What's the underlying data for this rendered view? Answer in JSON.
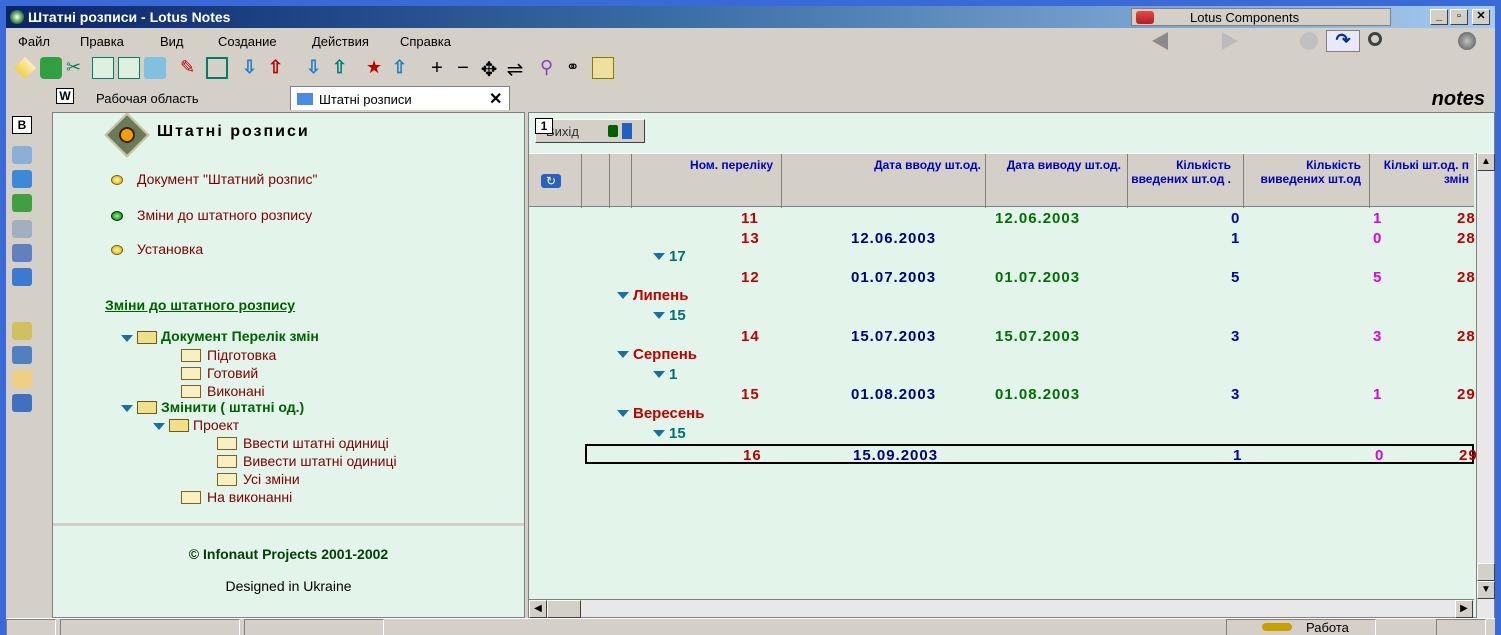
{
  "titlebar": {
    "title": "Штатні розписи - Lotus Notes",
    "components": "Lotus Components",
    "min": "_",
    "max": "▫",
    "close": "✕"
  },
  "menu": [
    "Файл",
    "Правка",
    "Вид",
    "Создание",
    "Действия",
    "Справка"
  ],
  "tabs": {
    "workspace": "Рабочая область",
    "active": "Штатні розписи",
    "close": "✕",
    "w": "W",
    "brand": "notes"
  },
  "left": {
    "title": "Штатні розписи",
    "links": [
      "Документ \"Штатний розпис\"",
      "Зміни до штатного розпису",
      "Установка"
    ],
    "section": "Зміни до штатного розпису",
    "tree": [
      {
        "label": "Документ Перелік змін",
        "level": 0,
        "type": "folder"
      },
      {
        "label": "Підготовка",
        "level": 1,
        "type": "doc"
      },
      {
        "label": "Готовий",
        "level": 1,
        "type": "doc"
      },
      {
        "label": "Виконані",
        "level": 1,
        "type": "doc"
      },
      {
        "label": "Змінити ( штатні од.)",
        "level": 0,
        "type": "folder"
      },
      {
        "label": "Проект",
        "level": 1,
        "type": "folder"
      },
      {
        "label": "Ввести штатні одиниці",
        "level": 2,
        "type": "doc"
      },
      {
        "label": "Вивести штатні одиниці",
        "level": 2,
        "type": "doc"
      },
      {
        "label": "Усі зміни",
        "level": 2,
        "type": "doc"
      },
      {
        "label": "На виконанні",
        "level": 1,
        "type": "doc"
      }
    ],
    "footer": {
      "copyright": "© Infonaut Projects 2001-2002",
      "designed": "Designed in Ukraine"
    },
    "b_label": "B"
  },
  "view": {
    "exit_label": "Вихід",
    "exit_num": "1",
    "columns": [
      "Ном. переліку",
      "Дата вводу шт.од.",
      "Дата виводу шт.од.",
      "Кількість введених шт.од .",
      "Кількість виведених шт.од",
      "Кількі шт.од. п змін"
    ],
    "rows": [
      {
        "kind": "row",
        "num": "11",
        "din": "",
        "dout": "12.06.2003",
        "in": "0",
        "out": "1",
        "tot": "28"
      },
      {
        "kind": "row",
        "num": "13",
        "din": "12.06.2003",
        "dout": "",
        "in": "1",
        "out": "0",
        "tot": "28"
      },
      {
        "kind": "sub",
        "label": "17"
      },
      {
        "kind": "row",
        "num": "12",
        "din": "01.07.2003",
        "dout": "01.07.2003",
        "in": "5",
        "out": "5",
        "tot": "28"
      },
      {
        "kind": "month",
        "label": "Липень"
      },
      {
        "kind": "sub",
        "label": "15"
      },
      {
        "kind": "row",
        "num": "14",
        "din": "15.07.2003",
        "dout": "15.07.2003",
        "in": "3",
        "out": "3",
        "tot": "28"
      },
      {
        "kind": "month",
        "label": "Серпень"
      },
      {
        "kind": "sub",
        "label": "1"
      },
      {
        "kind": "row",
        "num": "15",
        "din": "01.08.2003",
        "dout": "01.08.2003",
        "in": "3",
        "out": "1",
        "tot": "29"
      },
      {
        "kind": "month",
        "label": "Вересень"
      },
      {
        "kind": "sub",
        "label": "15"
      },
      {
        "kind": "row",
        "num": "16",
        "din": "15.09.2003",
        "dout": "",
        "in": "1",
        "out": "0",
        "tot": "29",
        "selected": true
      }
    ]
  },
  "status": {
    "work": "Работа"
  },
  "colors": {
    "num": "#c00000",
    "date": "#000080",
    "dateout": "#007000",
    "in": "#0000c0",
    "out": "#e000e0",
    "month": "#c00000",
    "sub": "#007070"
  }
}
